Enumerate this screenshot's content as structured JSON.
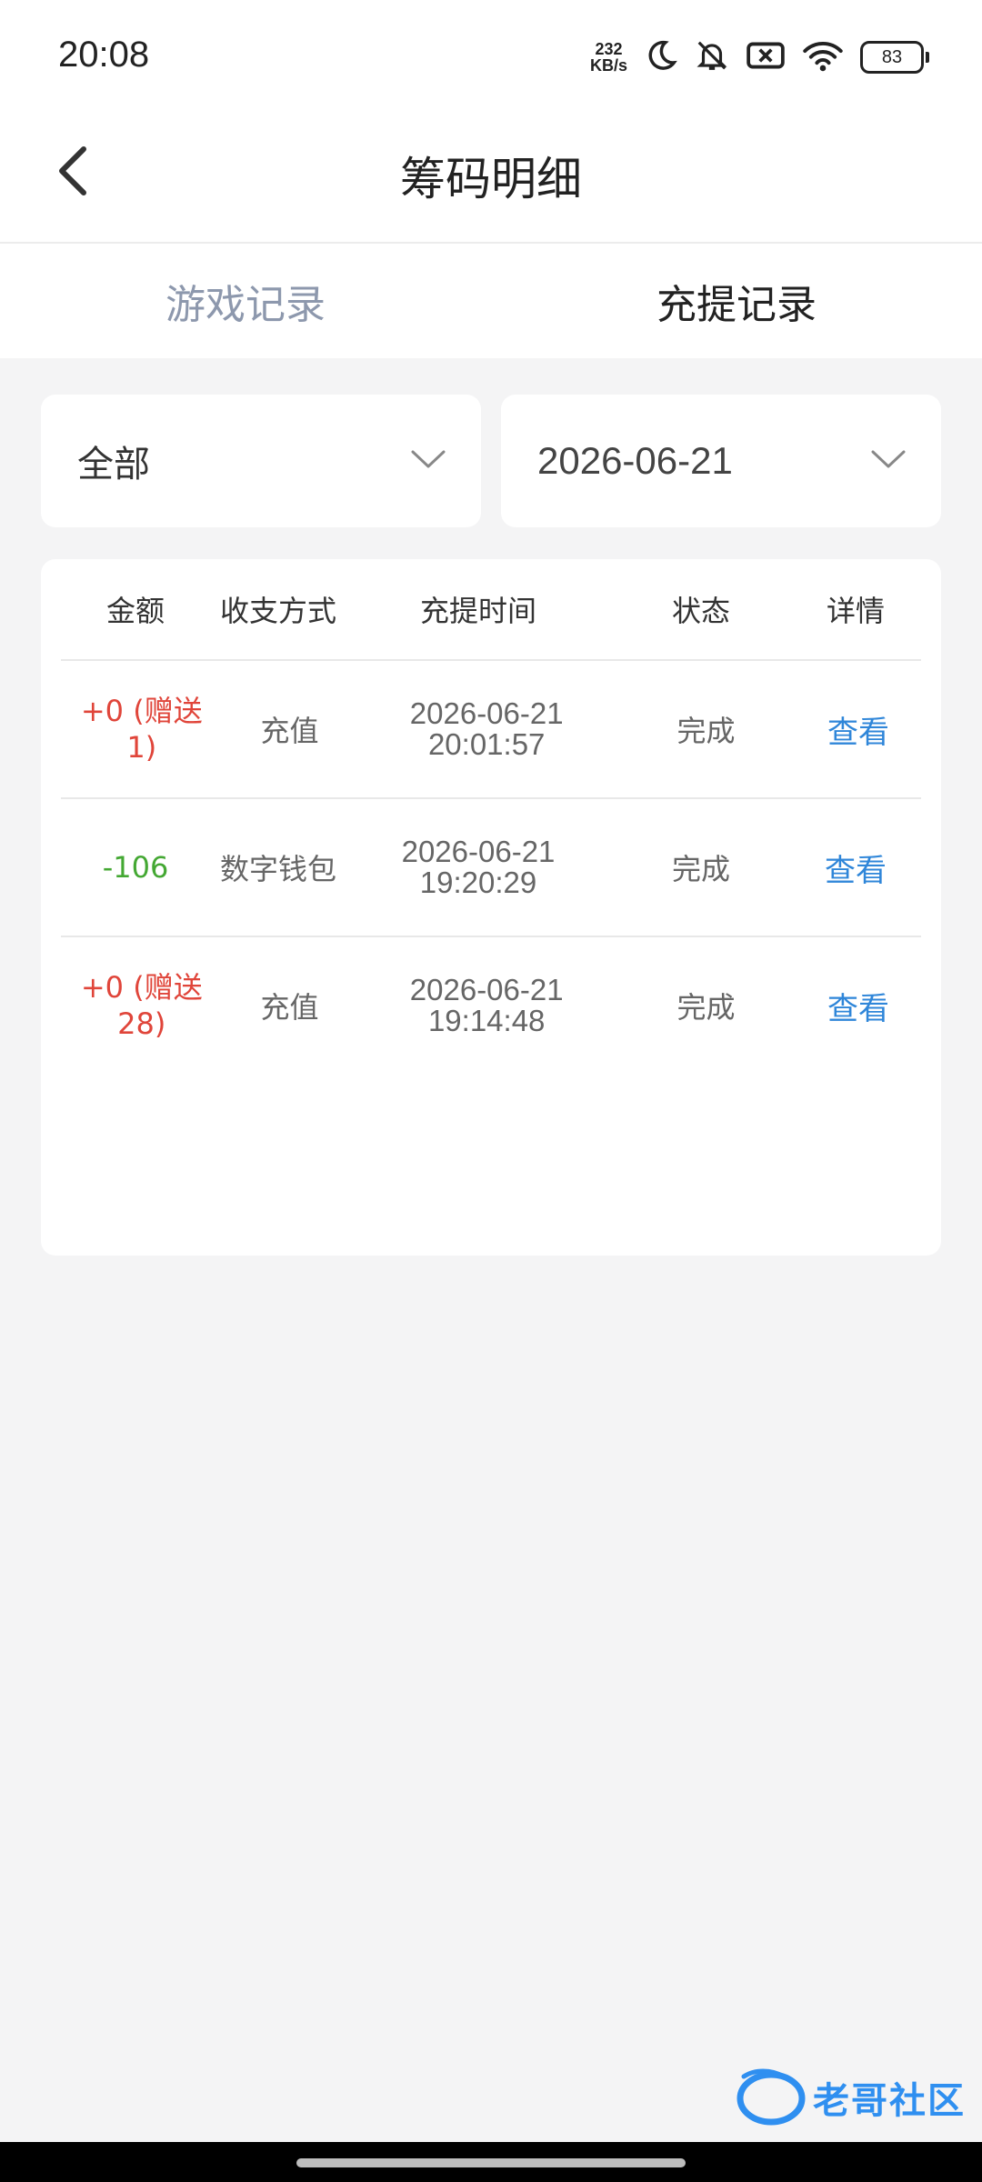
{
  "status_bar": {
    "time": "20:08",
    "net_speed_value": "232",
    "net_speed_unit": "KB/s",
    "battery": "83"
  },
  "header": {
    "title": "筹码明细"
  },
  "tabs": [
    {
      "label": "游戏记录",
      "active": false
    },
    {
      "label": "充提记录",
      "active": true
    }
  ],
  "filters": {
    "type": "全部",
    "date": "2026-06-21"
  },
  "table": {
    "columns": [
      "金额",
      "收支方式",
      "充提时间",
      "状态",
      "详情"
    ],
    "rows": [
      {
        "amount_line1": "+0 (赠送",
        "amount_line2": "1)",
        "method": "充值",
        "date": "2026-06-21",
        "time": "20:01:57",
        "status": "完成",
        "detail": "查看"
      },
      {
        "amount_line1": "-106",
        "amount_line2": "",
        "method": "数字钱包",
        "date": "2026-06-21",
        "time": "19:20:29",
        "status": "完成",
        "detail": "查看"
      },
      {
        "amount_line1": "+0 (赠送",
        "amount_line2": "28)",
        "method": "充值",
        "date": "2026-06-21",
        "time": "19:14:48",
        "status": "完成",
        "detail": "查看"
      }
    ]
  },
  "colors": {
    "positive_amount": "#e0453a",
    "negative_amount": "#44a833",
    "link": "#2f86d9",
    "inactive_tab": "#8d98ad"
  },
  "watermark": {
    "text": "老哥社区"
  }
}
